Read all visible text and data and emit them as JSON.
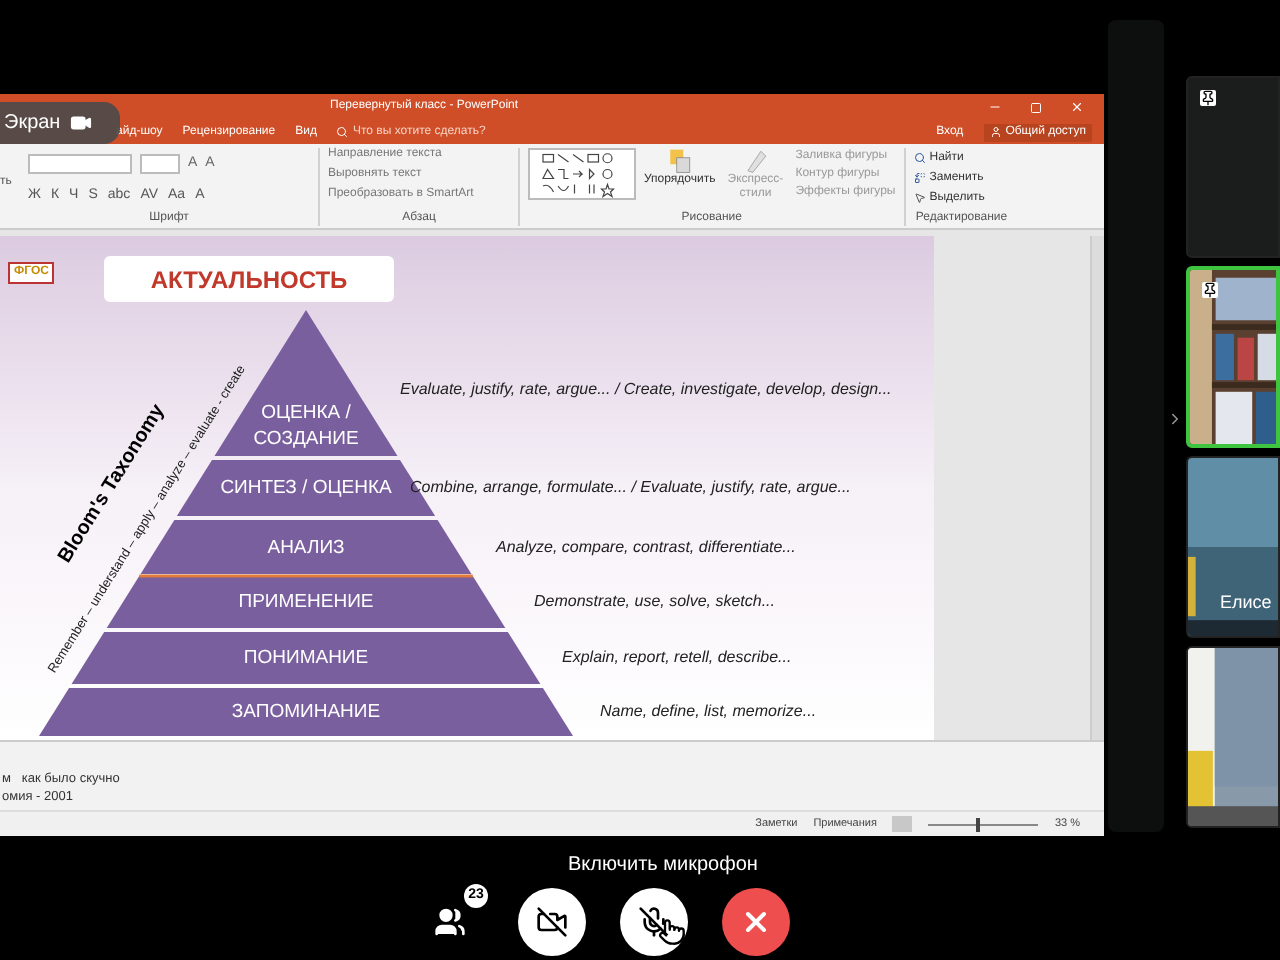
{
  "shared_screen": {
    "overlay_label": "Экран",
    "window": {
      "title": "Перевернутый класс - PowerPoint",
      "tabs": [
        "айд-шоу",
        "Рецензирование",
        "Вид"
      ],
      "search_hint": "Что вы хотите сделать?",
      "sign_in": "Вход",
      "share": "Общий доступ"
    },
    "ribbon": {
      "clipboard_fragment": "ть",
      "font_top": [
        "A",
        "A"
      ],
      "font_buttons": [
        "Ж",
        "К",
        "Ч",
        "S",
        "abc",
        "AV",
        "Aa",
        "A"
      ],
      "groups": [
        {
          "kind": "font",
          "label": "Шрифт"
        },
        {
          "kind": "paragraph",
          "label": "Абзац",
          "items": [
            "Направление текста",
            "Выровнять текст",
            "Преобразовать в SmartArt"
          ]
        },
        {
          "kind": "drawing",
          "label": "Рисование",
          "items": [
            "Упорядочить",
            "Экспресс-стили",
            "Заливка фигуры",
            "Контур фигуры",
            "Эффекты фигуры"
          ]
        },
        {
          "kind": "editing",
          "label": "Редактирование",
          "items": [
            "Найти",
            "Заменить",
            "Выделить"
          ]
        }
      ]
    },
    "slide": {
      "logo": "ФГОС",
      "title": "АКТУАЛЬНОСТЬ",
      "side_title": "Bloom's Taxonomy",
      "side_caption": "Remember – understand – apply – analyze – evaluate - create",
      "levels": [
        {
          "label": "ОЦЕНКА / СОЗДАНИЕ",
          "description": "Evaluate, justify, rate, argue... / Create, investigate, develop, design..."
        },
        {
          "label": "СИНТЕЗ / ОЦЕНКА",
          "description": "Combine, arrange, formulate... / Evaluate, justify, rate, argue..."
        },
        {
          "label": "АНАЛИЗ",
          "description": "Analyze, compare, contrast, differentiate..."
        },
        {
          "label": "ПРИМЕНЕНИЕ",
          "description": "Demonstrate, use, solve, sketch..."
        },
        {
          "label": "ПОНИМАНИЕ",
          "description": "Explain, report, retell, describe..."
        },
        {
          "label": "ЗАПОМИНАНИЕ",
          "description": "Name, define, list, memorize..."
        }
      ]
    },
    "notes": [
      "м   как было скучно",
      "омия - 2001"
    ],
    "status_bar": {
      "notes": "Заметки",
      "comments": "Примечания",
      "zoom": "33 %",
      "zoom_slider": {
        "level": 0.45
      }
    }
  },
  "participants": [
    {
      "kind": "empty",
      "speaking": false
    },
    {
      "kind": "video",
      "speaking": true
    },
    {
      "kind": "video",
      "speaking": false,
      "name": "Елисе"
    },
    {
      "kind": "video",
      "speaking": false
    }
  ],
  "call_bar": {
    "tooltip": "Включить микрофон",
    "participant_count": "23",
    "controls": [
      {
        "kind": "camera",
        "on": false
      },
      {
        "kind": "microphone",
        "on": false
      },
      {
        "kind": "leave"
      }
    ]
  }
}
